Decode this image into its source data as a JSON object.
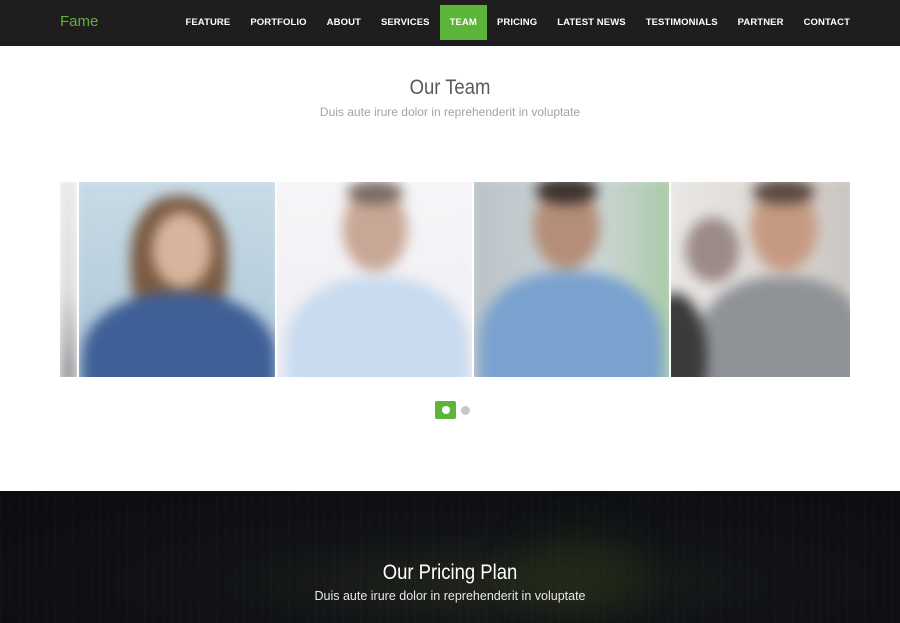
{
  "brand": "Fame",
  "nav": {
    "items": [
      {
        "label": "FEATURE"
      },
      {
        "label": "PORTFOLIO"
      },
      {
        "label": "ABOUT"
      },
      {
        "label": "SERVICES"
      },
      {
        "label": "TEAM",
        "active": true
      },
      {
        "label": "PRICING"
      },
      {
        "label": "LATEST NEWS"
      },
      {
        "label": "TESTIMONIALS"
      },
      {
        "label": "PARTNER"
      },
      {
        "label": "CONTACT"
      }
    ]
  },
  "team": {
    "title": "Our Team",
    "subtitle": "Duis aute irure dolor in reprehenderit in voluptate",
    "carousel": {
      "slide_count": 2,
      "active_slide": 1
    }
  },
  "pricing": {
    "title": "Our Pricing Plan",
    "subtitle": "Duis aute irure dolor in reprehenderit in voluptate"
  },
  "colors": {
    "accent": "#5db43a",
    "navbar_bg": "#1f1d1e"
  }
}
